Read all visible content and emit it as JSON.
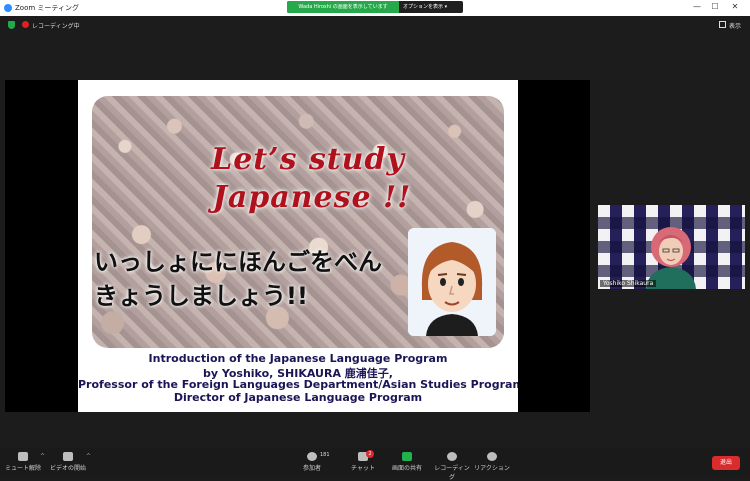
{
  "window": {
    "title": "Zoom ミーティング",
    "share_notice": "Wada Hiroshi の画面を表示しています",
    "view_options": "オプションを表示 ▾",
    "minimize": "—",
    "maximize": "☐",
    "close": "✕"
  },
  "topbar": {
    "recording": "レコーディング中",
    "view": "表示"
  },
  "slide": {
    "title_line1": "Let’s study",
    "title_line2": "Japanese !!",
    "jp_line1": "いっしょににほんごをべん",
    "jp_line2": "きょうしましょう!!",
    "credit_line1": "Introduction of the Japanese Language Program",
    "credit_line2": "by Yoshiko, SHIKAURA  鹿浦佳子,",
    "credit_line3": "Professor of the Foreign Languages Department/Asian Studies Program",
    "credit_line4": "Director of Japanese Language Program"
  },
  "participant": {
    "name": "Yoshiko Shikaura"
  },
  "toolbar": {
    "mute": "ミュート解除",
    "video": "ビデオの開始",
    "participants": "参加者",
    "participants_count": "181",
    "chat": "チャット",
    "chat_badge": "2",
    "share": "画面の共有",
    "record": "レコーディング",
    "reactions": "リアクション",
    "leave": "退出"
  },
  "colors": {
    "accent_green": "#25a94a",
    "slide_title_red": "#b0121d",
    "credit_navy": "#1a1556",
    "leave_red": "#d92d2d"
  }
}
